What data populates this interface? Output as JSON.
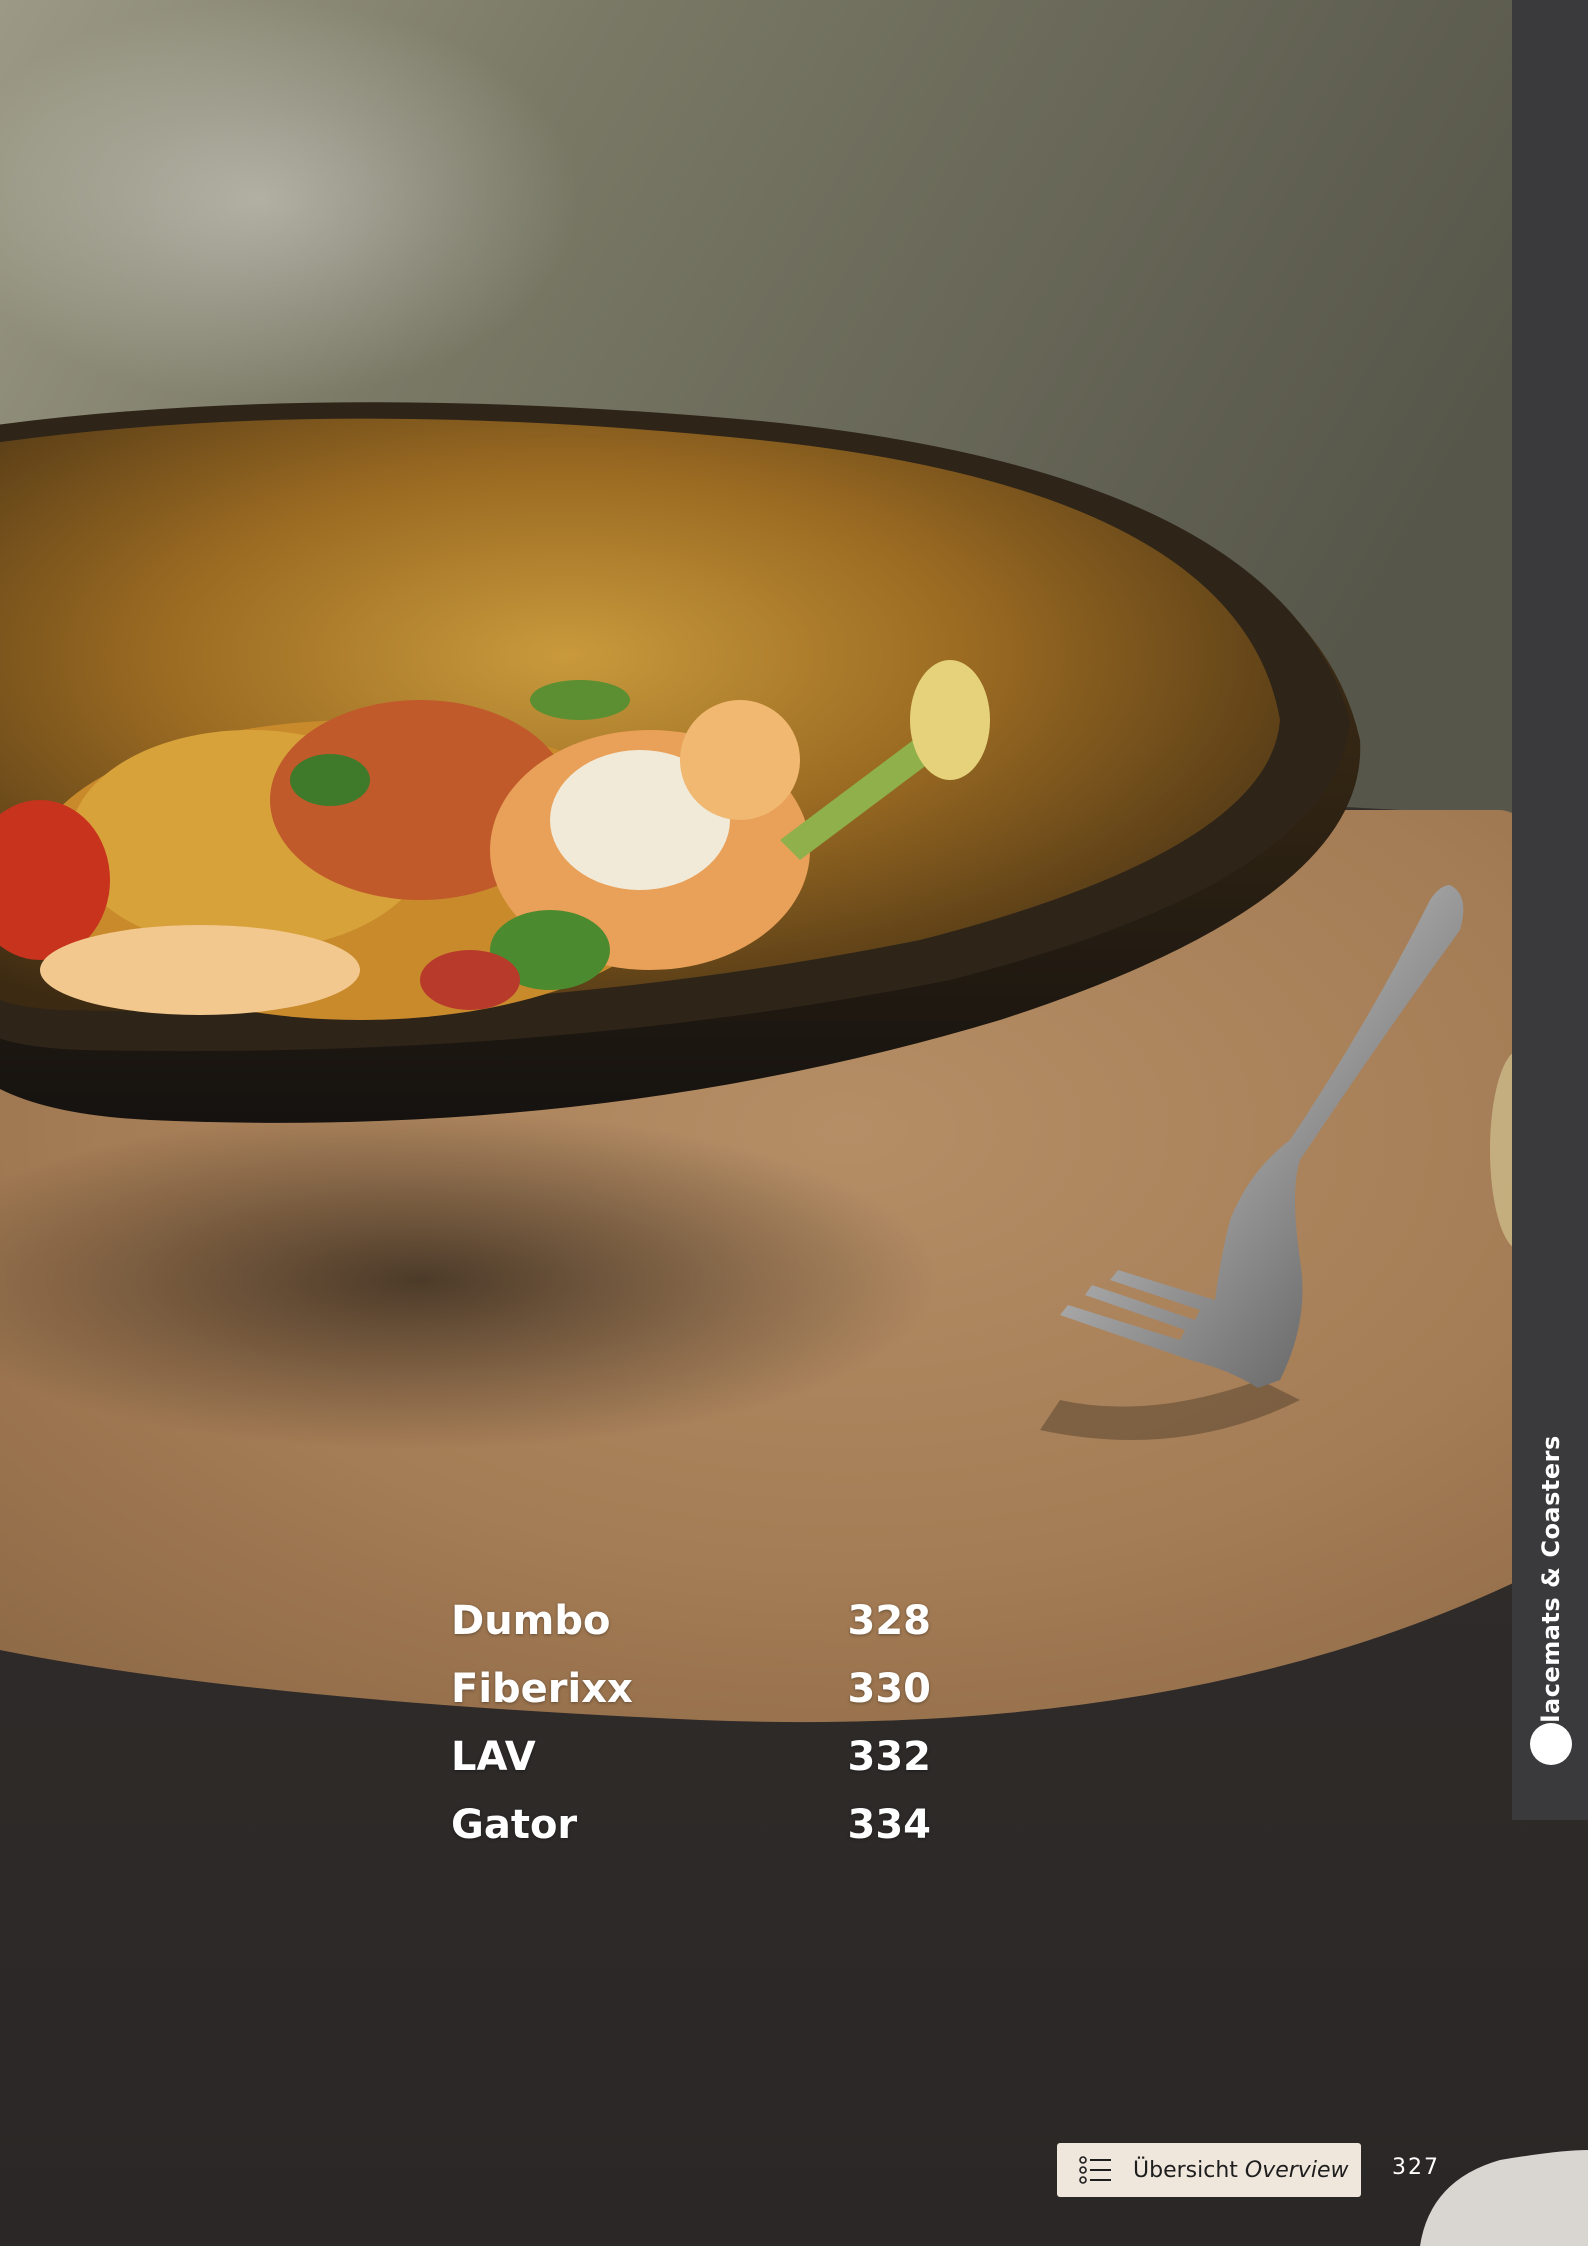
{
  "side_tab": {
    "label": "Placemats & Coasters"
  },
  "toc": {
    "entries": [
      {
        "name": "Dumbo",
        "page": "328"
      },
      {
        "name": "Fiberixx",
        "page": "330"
      },
      {
        "name": "LAV",
        "page": "332"
      },
      {
        "name": "Gator",
        "page": "334"
      }
    ]
  },
  "footer": {
    "overview_de": "Übersicht",
    "overview_en": "Overview",
    "page_number": "327"
  },
  "photo": {
    "subject": "salad in bronze-glazed bowl with fork on leather placemat",
    "colors": {
      "table": "#2e2a28",
      "placemat": "#a47c55",
      "bowl_rim": "#3a2c18",
      "background": "#6b6b55"
    }
  }
}
